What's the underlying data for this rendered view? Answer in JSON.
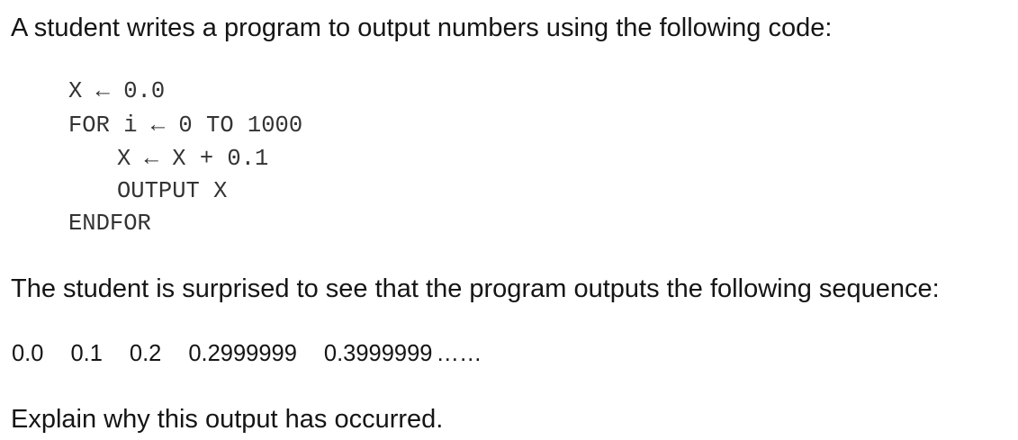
{
  "question": {
    "intro": "A student writes a program to output numbers using the following code:",
    "code_lines": [
      "X ← 0.0",
      "FOR i ← 0 TO 1000",
      "X ← X + 0.1",
      "OUTPUT X",
      "ENDFOR"
    ],
    "surprise_text": "The student is surprised to see that the program outputs the following sequence:",
    "sequence": [
      "0.0",
      "0.1",
      "0.2",
      "0.2999999",
      "0.3999999"
    ],
    "sequence_ellipsis": "……",
    "explain_prompt": "Explain why this output has occurred."
  }
}
